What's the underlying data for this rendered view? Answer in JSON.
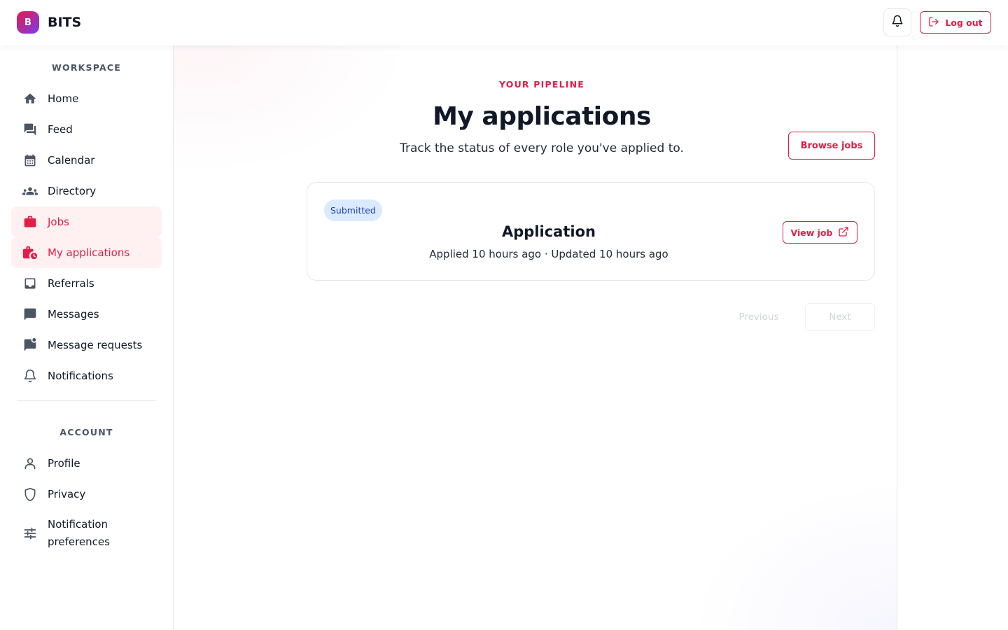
{
  "app": {
    "logo_letter": "B",
    "name": "BITS"
  },
  "header": {
    "logout_label": "Log out"
  },
  "sidebar": {
    "workspace_title": "WORKSPACE",
    "workspace_items": [
      {
        "label": "Home",
        "icon": "home-icon"
      },
      {
        "label": "Feed",
        "icon": "forum-icon"
      },
      {
        "label": "Calendar",
        "icon": "calendar-icon"
      },
      {
        "label": "Directory",
        "icon": "groups-icon"
      },
      {
        "label": "Jobs",
        "icon": "briefcase-icon"
      },
      {
        "label": "My applications",
        "icon": "briefcase-clock-icon"
      },
      {
        "label": "Referrals",
        "icon": "inbox-icon"
      },
      {
        "label": "Messages",
        "icon": "chat-icon"
      },
      {
        "label": "Message requests",
        "icon": "chat-unread-icon"
      },
      {
        "label": "Notifications",
        "icon": "bell-icon"
      }
    ],
    "account_title": "ACCOUNT",
    "account_items": [
      {
        "label": "Profile",
        "icon": "person-icon"
      },
      {
        "label": "Privacy",
        "icon": "shield-icon"
      },
      {
        "label_line1": "Notification",
        "label_line2": "preferences",
        "icon": "sliders-icon"
      }
    ]
  },
  "main": {
    "eyebrow": "YOUR PIPELINE",
    "title": "My applications",
    "subtitle": "Track the status of every role you've applied to.",
    "browse_label": "Browse jobs",
    "application": {
      "status": "Submitted",
      "title": "Application",
      "meta": "Applied 10 hours ago · Updated 10 hours ago",
      "view_label": "View job"
    },
    "pagination": {
      "previous_label": "Previous",
      "next_label": "Next"
    }
  },
  "colors": {
    "accent": "#e11d48",
    "active_bg": "#fff1f2",
    "badge_bg": "#dbeafe",
    "badge_text": "#1e40af",
    "icon_gray": "#4b5563"
  }
}
